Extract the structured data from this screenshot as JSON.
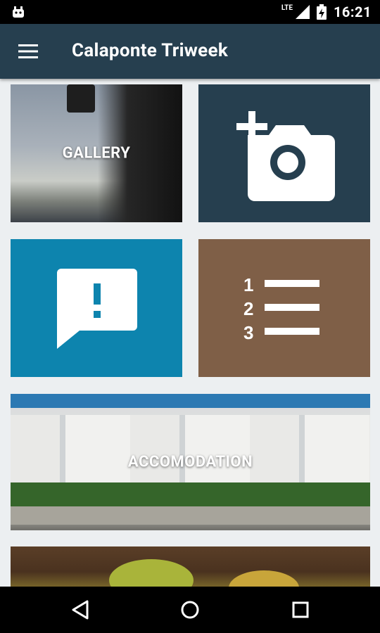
{
  "status_bar": {
    "network": "LTE",
    "time": "16:21",
    "icons": [
      "android-notification-icon",
      "signal-icon",
      "battery-icon"
    ]
  },
  "app_bar": {
    "title": "Calaponte Triweek",
    "menu_icon": "hamburger-menu-icon"
  },
  "tiles": {
    "gallery": {
      "label": "GALLERY"
    },
    "camera": {
      "icon": "add-photo-icon",
      "color": "#263f4f"
    },
    "feedback": {
      "icon": "feedback-icon",
      "color": "#0d84ae"
    },
    "ranking": {
      "icon": "numbered-list-icon",
      "color": "#7f5f47"
    },
    "accomodation": {
      "label": "ACCOMODATION"
    }
  },
  "nav_bar": {
    "icons": [
      "back-icon",
      "home-icon",
      "recents-icon"
    ]
  },
  "colors": {
    "app_bar": "#263f4f",
    "background": "#eceff1"
  }
}
